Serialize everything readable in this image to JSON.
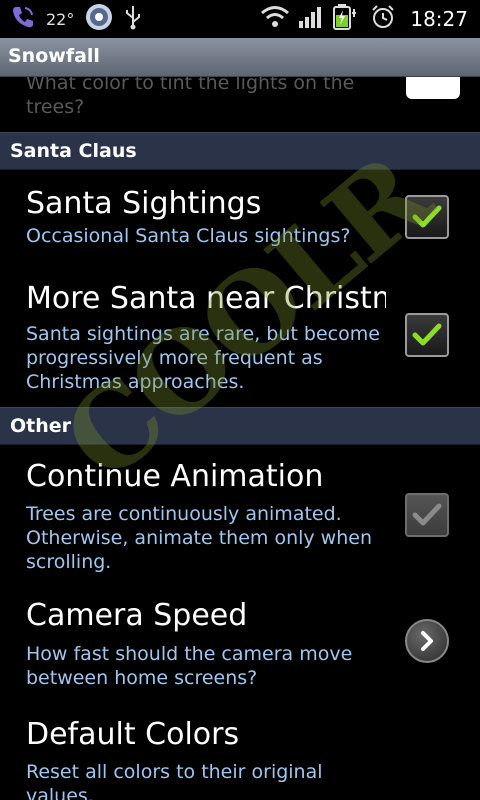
{
  "status_bar": {
    "temperature": "22°",
    "time": "18:27",
    "icons": [
      "phone-icon",
      "weather-icon",
      "usb-icon",
      "wifi-icon",
      "signal-icon",
      "battery-charging-icon",
      "alarm-icon"
    ]
  },
  "title_bar": {
    "title": "Snowfall"
  },
  "partial_pref": {
    "summary": "What color to tint the lights on the trees?"
  },
  "sections": {
    "santa": {
      "header": "Santa Claus",
      "sightings": {
        "title": "Santa Sightings",
        "summary": "Occasional Santa Claus sightings?",
        "checked": true
      },
      "more_santa": {
        "title": "More Santa near Christmas",
        "summary": "Santa sightings are rare, but become progressively more frequent as Christmas approaches.",
        "checked": true
      }
    },
    "other": {
      "header": "Other",
      "continue_anim": {
        "title": "Continue Animation",
        "summary": "Trees are continuously animated. Otherwise, animate them only when scrolling.",
        "checked": true
      },
      "camera_speed": {
        "title": "Camera Speed",
        "summary": "How fast should the camera move between home screens?"
      },
      "default_colors": {
        "title": "Default Colors",
        "summary": "Reset all colors to their original values."
      }
    }
  },
  "watermark": "COOLR",
  "colors": {
    "check": "#8ddc2a",
    "summary_text": "#9fc7ee",
    "section_bg": "#2a3347"
  }
}
